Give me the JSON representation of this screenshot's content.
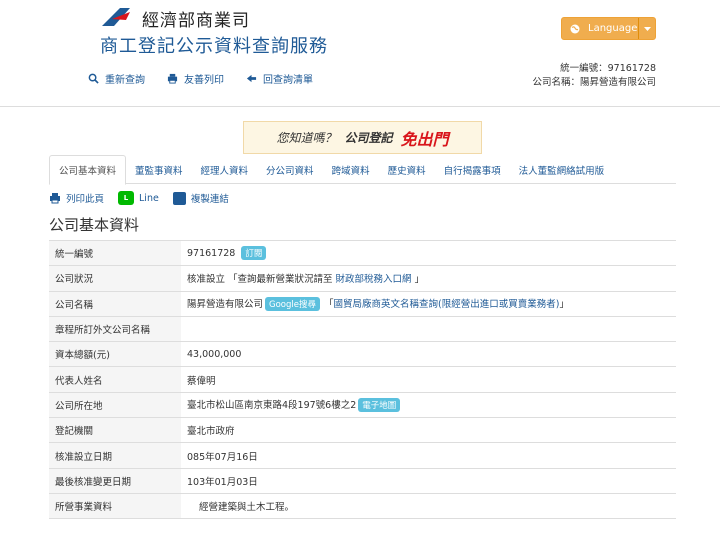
{
  "header": {
    "ministry": "經濟部商業司",
    "site_title": "商工登記公示資料查詢服務",
    "language_label": "Language",
    "tax_id_line": "統一編號：97161728",
    "company_line": "公司名稱：陽昇營造有限公司"
  },
  "toolbar": {
    "requery": "重新查詢",
    "print": "友善列印",
    "back": "回查詢清單"
  },
  "banner": {
    "question": "您知道嗎？",
    "registration": "公司登記",
    "free": "免出門"
  },
  "tabs": [
    {
      "label": "公司基本資料"
    },
    {
      "label": "董監事資料"
    },
    {
      "label": "經理人資料"
    },
    {
      "label": "分公司資料"
    },
    {
      "label": "跨域資料"
    },
    {
      "label": "歷史資料"
    },
    {
      "label": "自行揭露事項"
    },
    {
      "label": "法人董監網絡試用版"
    }
  ],
  "actions": {
    "print": "列印此頁",
    "line": "Line",
    "copy_link": "複製連結"
  },
  "section_title": "公司基本資料",
  "rows": {
    "tax_id": {
      "label": "統一編號",
      "value": "97161728",
      "badge": "訂閱"
    },
    "status": {
      "label": "公司狀況",
      "value_pre": "核准設立 「查詢最新營業狀況請至 ",
      "link": "財政部稅務入口網",
      "value_post": " 」"
    },
    "name": {
      "label": "公司名稱",
      "value": "陽昇營造有限公司",
      "badge": "Google搜尋",
      "value_pre2": "「",
      "link": "國貿局廠商英文名稱查詢(限經營出進口或買賣業務者)",
      "value_post": "」"
    },
    "foreign_name": {
      "label": "章程所訂外文公司名稱",
      "value": ""
    },
    "capital": {
      "label": "資本總額(元)",
      "value": "43,000,000"
    },
    "representative": {
      "label": "代表人姓名",
      "value": "蔡偉明"
    },
    "address": {
      "label": "公司所在地",
      "value": "臺北市松山區南京東路4段197號6樓之2",
      "badge": "電子地圖"
    },
    "authority": {
      "label": "登記機關",
      "value": "臺北市政府"
    },
    "approval_date": {
      "label": "核准設立日期",
      "value": "085年07月16日"
    },
    "last_change_date": {
      "label": "最後核准變更日期",
      "value": "103年01月03日"
    },
    "business": {
      "label": "所營事業資料",
      "value": "經營建築與土木工程。"
    }
  },
  "colors": {
    "accent": "#1f5a96",
    "language_button": "#f0ad4e",
    "badge": "#5bc0de",
    "free_text": "#d9161c"
  }
}
